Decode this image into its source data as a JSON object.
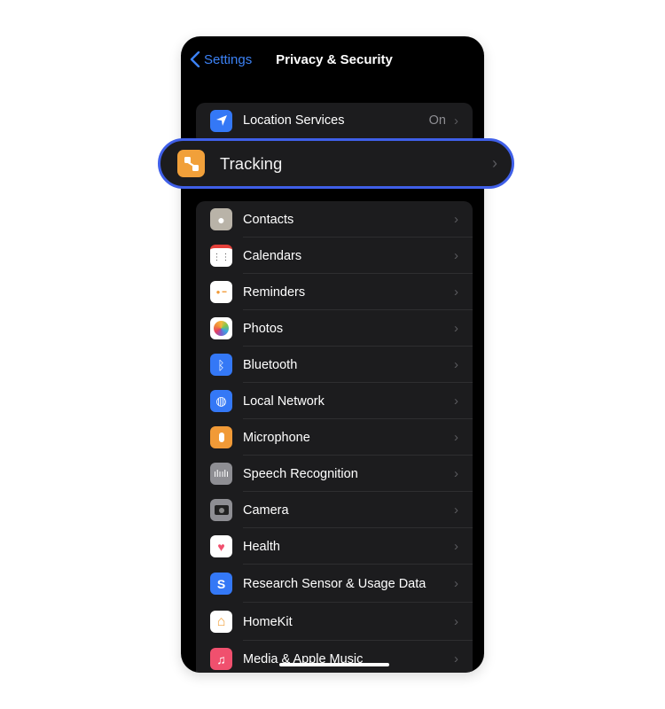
{
  "nav": {
    "back_label": "Settings",
    "title": "Privacy & Security"
  },
  "location": {
    "label": "Location Services",
    "value": "On",
    "icon": "location-arrow-icon",
    "color": "#3478f6"
  },
  "tracking": {
    "label": "Tracking",
    "icon": "tracking-icon",
    "color": "#f1a03a",
    "highlight_color": "#3f5fe8"
  },
  "items": [
    {
      "label": "Contacts",
      "icon": "contacts-icon",
      "color": "#b9b3a8"
    },
    {
      "label": "Calendars",
      "icon": "calendar-icon",
      "color": "#ffffff"
    },
    {
      "label": "Reminders",
      "icon": "reminders-icon",
      "color": "#ffffff"
    },
    {
      "label": "Photos",
      "icon": "photos-icon",
      "color": "#ffffff"
    },
    {
      "label": "Bluetooth",
      "icon": "bluetooth-icon",
      "color": "#3478f6"
    },
    {
      "label": "Local Network",
      "icon": "globe-icon",
      "color": "#3478f6"
    },
    {
      "label": "Microphone",
      "icon": "microphone-icon",
      "color": "#f19a37"
    },
    {
      "label": "Speech Recognition",
      "icon": "waveform-icon",
      "color": "#8e8e93"
    },
    {
      "label": "Camera",
      "icon": "camera-icon",
      "color": "#8e8e93"
    },
    {
      "label": "Health",
      "icon": "heart-icon",
      "color": "#ffffff"
    },
    {
      "label": "Research Sensor & Usage Data",
      "icon": "research-icon",
      "color": "#3478f6"
    },
    {
      "label": "HomeKit",
      "icon": "home-icon",
      "color": "#ffffff"
    },
    {
      "label": "Media & Apple Music",
      "icon": "music-note-icon",
      "color": "#f0506e"
    }
  ]
}
